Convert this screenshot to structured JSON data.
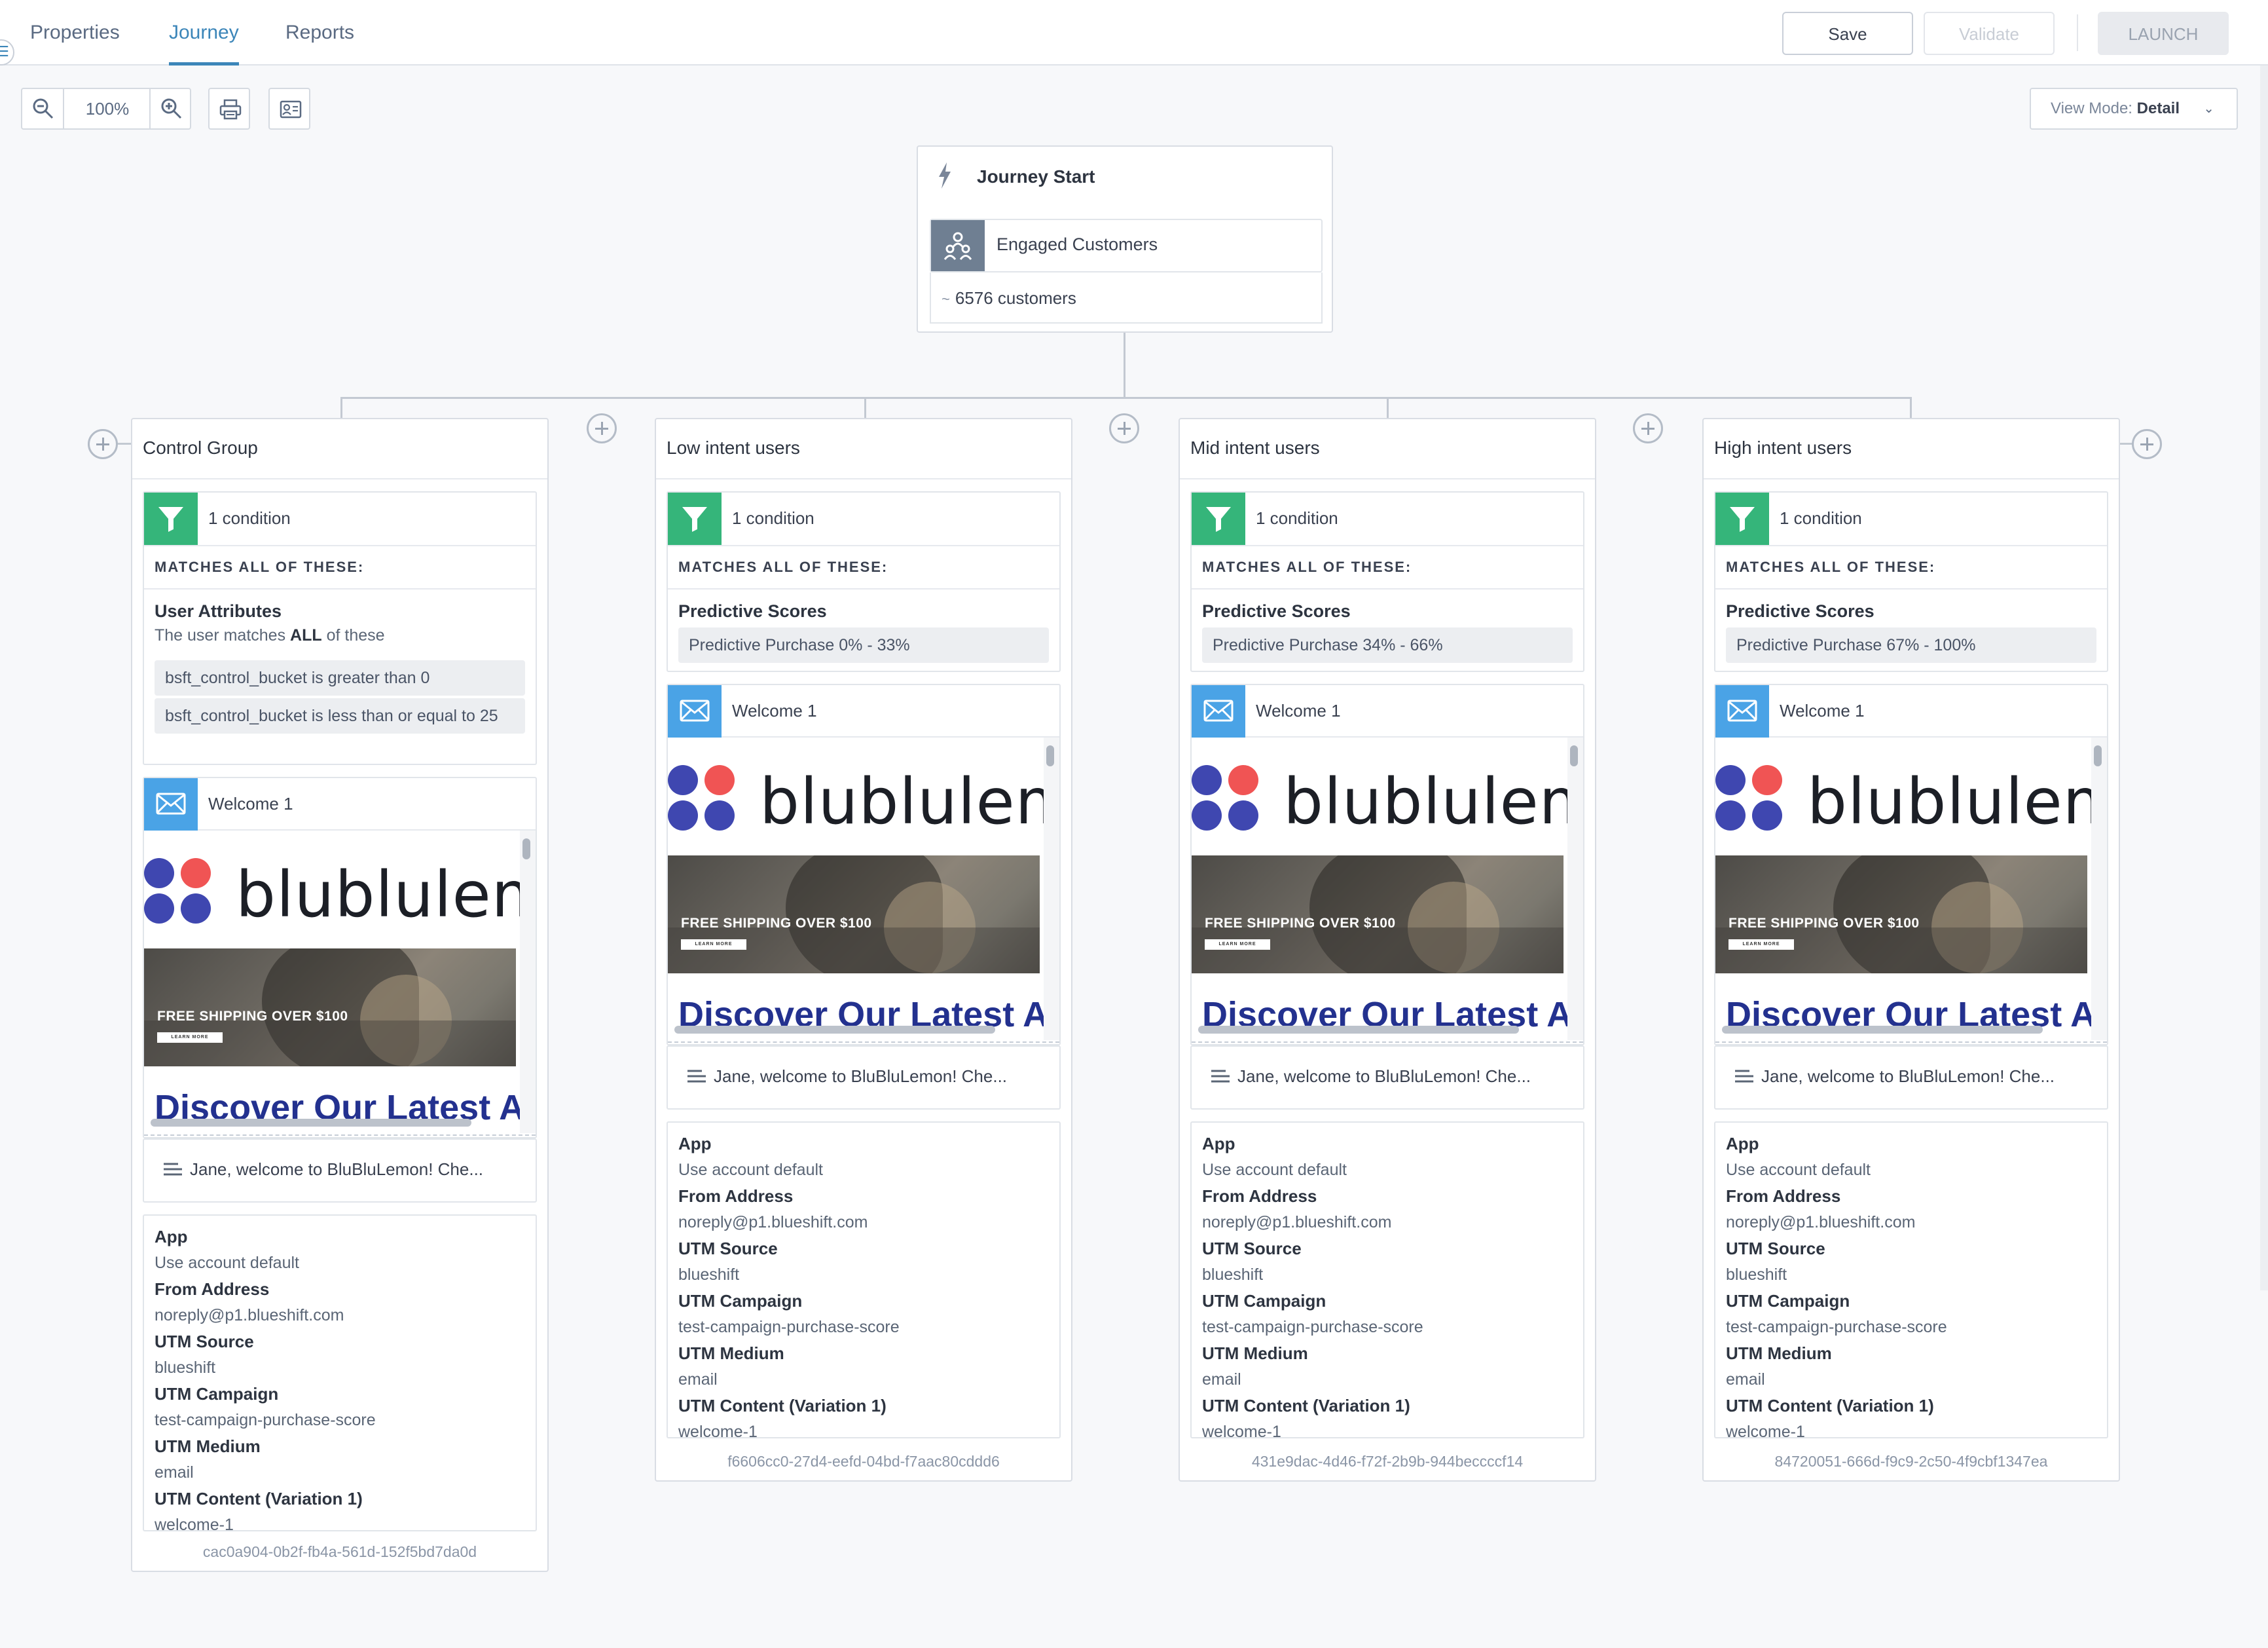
{
  "nav": {
    "tabs": [
      {
        "label": "Properties",
        "active": false
      },
      {
        "label": "Journey",
        "active": true
      },
      {
        "label": "Reports",
        "active": false
      }
    ],
    "save_label": "Save",
    "validate_label": "Validate",
    "launch_label": "LAUNCH"
  },
  "toolbar": {
    "zoom_level": "100%",
    "view_mode_label": "View Mode:",
    "view_mode_value": "Detail"
  },
  "start": {
    "title": "Journey Start",
    "segment_name": "Engaged Customers",
    "count_prefix": "~",
    "count": "6576 customers"
  },
  "colors": {
    "accent": "#3c86b9",
    "condition_icon": "#35b57a",
    "email_icon": "#4aa3e6",
    "segment_icon": "#6f7f92",
    "brand_blue": "#3f47b0",
    "brand_red": "#f05454"
  },
  "branches": [
    {
      "title": "Control Group",
      "condition_count": "1 condition",
      "matches": "MATCHES ALL OF THESE:",
      "condition_type": "User Attributes",
      "condition_sub_pre": "The user matches ",
      "condition_sub_bold": "ALL",
      "condition_sub_post": " of these",
      "rules": [
        "bsft_control_bucket is greater than 0",
        "bsft_control_bucket is less than or equal to 25"
      ],
      "email_name": "Welcome 1",
      "brand_text": "blublulemon",
      "hero_text": "FREE SHIPPING OVER $100",
      "hero_button": "LEARN MORE",
      "discover_text": "Discover Our Latest Acti",
      "subject": "Jane, welcome to BluBluLemon! Che...",
      "meta": [
        {
          "label": "App",
          "value": "Use account default"
        },
        {
          "label": "From Address",
          "value": "noreply@p1.blueshift.com"
        },
        {
          "label": "UTM Source",
          "value": "blueshift"
        },
        {
          "label": "UTM Campaign",
          "value": "test-campaign-purchase-score"
        },
        {
          "label": "UTM Medium",
          "value": "email"
        },
        {
          "label": "UTM Content (Variation 1)",
          "value": "welcome-1"
        }
      ],
      "uuid": "cac0a904-0b2f-fb4a-561d-152f5bd7da0d"
    },
    {
      "title": "Low intent users",
      "condition_count": "1 condition",
      "matches": "MATCHES ALL OF THESE:",
      "condition_type": "Predictive Scores",
      "rules": [
        "Predictive Purchase 0% - 33%"
      ],
      "email_name": "Welcome 1",
      "brand_text": "blublulemon",
      "hero_text": "FREE SHIPPING OVER $100",
      "hero_button": "LEARN MORE",
      "discover_text": "Discover Our Latest Acti",
      "subject": "Jane, welcome to BluBluLemon! Che...",
      "meta": [
        {
          "label": "App",
          "value": "Use account default"
        },
        {
          "label": "From Address",
          "value": "noreply@p1.blueshift.com"
        },
        {
          "label": "UTM Source",
          "value": "blueshift"
        },
        {
          "label": "UTM Campaign",
          "value": "test-campaign-purchase-score"
        },
        {
          "label": "UTM Medium",
          "value": "email"
        },
        {
          "label": "UTM Content (Variation 1)",
          "value": "welcome-1"
        }
      ],
      "uuid": "f6606cc0-27d4-eefd-04bd-f7aac80cddd6"
    },
    {
      "title": "Mid intent users",
      "condition_count": "1 condition",
      "matches": "MATCHES ALL OF THESE:",
      "condition_type": "Predictive Scores",
      "rules": [
        "Predictive Purchase 34% - 66%"
      ],
      "email_name": "Welcome 1",
      "brand_text": "blublulemon",
      "hero_text": "FREE SHIPPING OVER $100",
      "hero_button": "LEARN MORE",
      "discover_text": "Discover Our Latest Acti",
      "subject": "Jane, welcome to BluBluLemon! Che...",
      "meta": [
        {
          "label": "App",
          "value": "Use account default"
        },
        {
          "label": "From Address",
          "value": "noreply@p1.blueshift.com"
        },
        {
          "label": "UTM Source",
          "value": "blueshift"
        },
        {
          "label": "UTM Campaign",
          "value": "test-campaign-purchase-score"
        },
        {
          "label": "UTM Medium",
          "value": "email"
        },
        {
          "label": "UTM Content (Variation 1)",
          "value": "welcome-1"
        }
      ],
      "uuid": "431e9dac-4d46-f72f-2b9b-944beccccf14"
    },
    {
      "title": "High intent users",
      "condition_count": "1 condition",
      "matches": "MATCHES ALL OF THESE:",
      "condition_type": "Predictive Scores",
      "rules": [
        "Predictive Purchase 67% - 100%"
      ],
      "email_name": "Welcome 1",
      "brand_text": "blublulemon",
      "hero_text": "FREE SHIPPING OVER $100",
      "hero_button": "LEARN MORE",
      "discover_text": "Discover Our Latest Acti",
      "subject": "Jane, welcome to BluBluLemon! Che...",
      "meta": [
        {
          "label": "App",
          "value": "Use account default"
        },
        {
          "label": "From Address",
          "value": "noreply@p1.blueshift.com"
        },
        {
          "label": "UTM Source",
          "value": "blueshift"
        },
        {
          "label": "UTM Campaign",
          "value": "test-campaign-purchase-score"
        },
        {
          "label": "UTM Medium",
          "value": "email"
        },
        {
          "label": "UTM Content (Variation 1)",
          "value": "welcome-1"
        }
      ],
      "uuid": "84720051-666d-f9c9-2c50-4f9cbf1347ea"
    }
  ]
}
